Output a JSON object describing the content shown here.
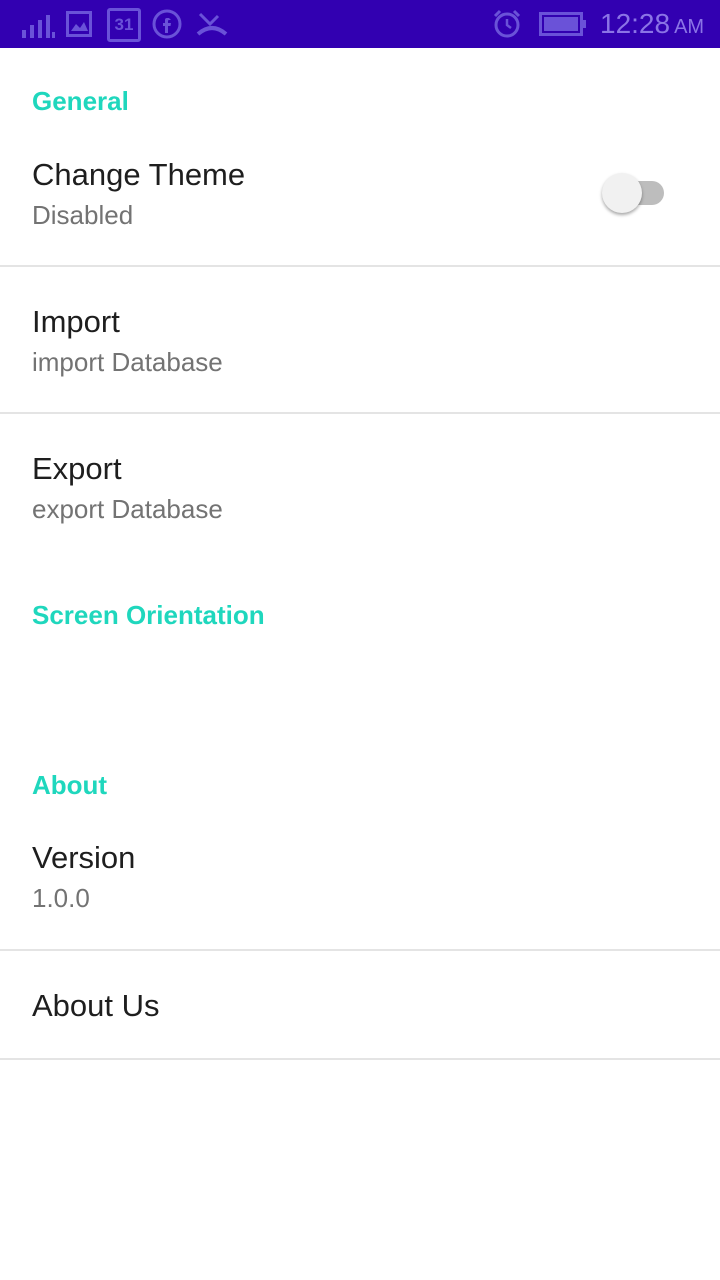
{
  "status_bar": {
    "time": "12:28",
    "ampm": "AM",
    "calendar_day": "31",
    "icons": [
      "signal-icon",
      "image-icon",
      "calendar-icon",
      "facebook-icon",
      "missed-call-icon",
      "alarm-icon",
      "battery-icon"
    ]
  },
  "sections": {
    "general": "General",
    "screen_orientation": "Screen Orientation",
    "about": "About"
  },
  "prefs": {
    "change_theme": {
      "title": "Change Theme",
      "summary": "Disabled",
      "enabled": false
    },
    "import": {
      "title": "Import",
      "summary": "import Database"
    },
    "export": {
      "title": "Export",
      "summary": "export Database"
    },
    "version": {
      "title": "Version",
      "summary": "1.0.0"
    },
    "about_us": {
      "title": "About Us"
    }
  },
  "colors": {
    "status_bar": "#3200b1",
    "accent": "#1fd7bd"
  }
}
